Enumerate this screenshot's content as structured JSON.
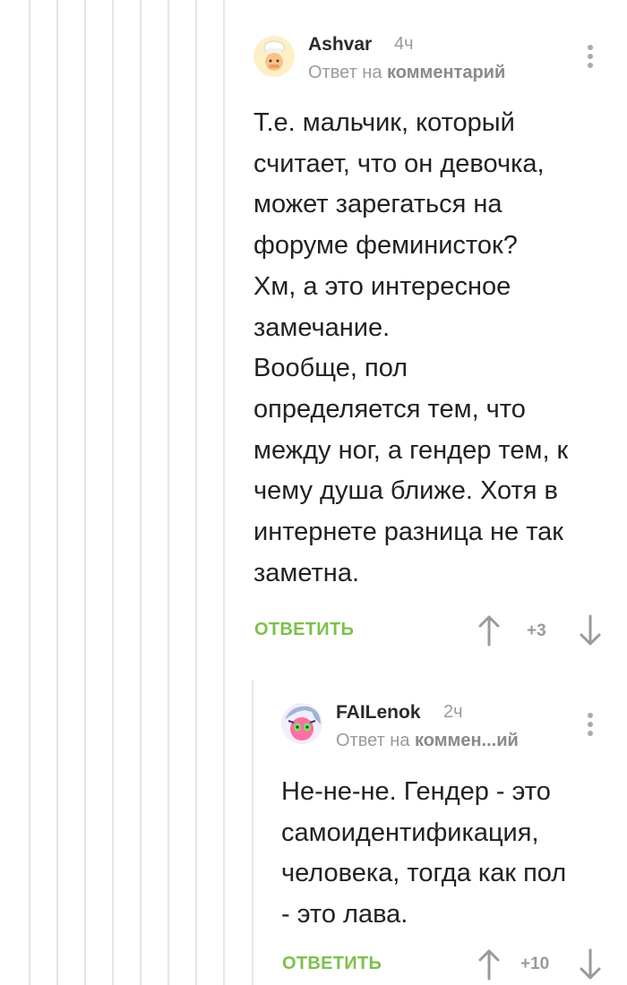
{
  "comments": [
    {
      "author": "Ashvar",
      "time": "4ч",
      "reply_prefix": "Ответ на",
      "reply_target": "комментарий",
      "lines": [
        "Т.е. мальчик, который",
        "считает, что он девочка,",
        "может зарегаться на",
        "форуме феминисток?",
        "Хм, а это интересное",
        "замечание.",
        "Вообще, пол",
        "определяется тем, что",
        "между ног, а гендер тем, к",
        "чему душа ближе. Хотя в",
        "интернете разница не так",
        "заметна."
      ],
      "reply_label": "ОТВЕТИТЬ",
      "score": "+3"
    },
    {
      "author": "FAILenok",
      "time": "2ч",
      "reply_prefix": "Ответ на",
      "reply_target": "коммен...ий",
      "lines": [
        "Не-не-не. Гендер - это",
        "самоидентификация,",
        "человека, тогда как пол",
        "- это лава."
      ],
      "reply_label": "ОТВЕТИТЬ",
      "score": "+10"
    }
  ],
  "colors": {
    "accent": "#7cc14a",
    "muted": "#9a9a9a",
    "thread_line": "#e6e6e6"
  }
}
